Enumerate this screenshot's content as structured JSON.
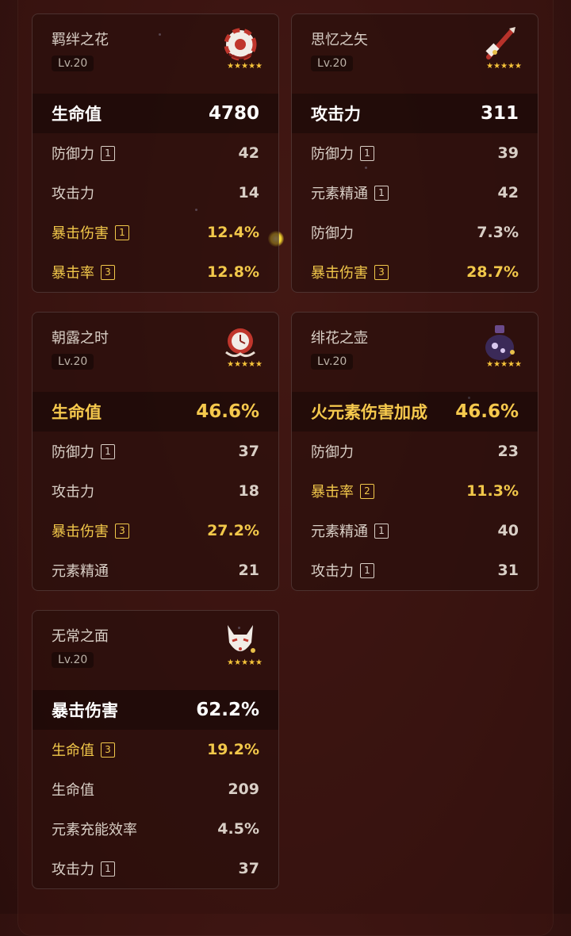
{
  "colors": {
    "highlight": "#f2c84a",
    "rarity_star": "#f5c33a",
    "background": "#3a1512"
  },
  "artifacts": [
    {
      "name": "羁绊之花",
      "level": "Lv.20",
      "rarity": "★★★★★",
      "icon": "flower-icon",
      "main": {
        "name": "生命值",
        "value": "4780",
        "highlight": false
      },
      "subs": [
        {
          "name": "防御力",
          "badge": "1",
          "value": "42",
          "highlight": false
        },
        {
          "name": "攻击力",
          "badge": "",
          "value": "14",
          "highlight": false
        },
        {
          "name": "暴击伤害",
          "badge": "1",
          "value": "12.4%",
          "highlight": true
        },
        {
          "name": "暴击率",
          "badge": "3",
          "value": "12.8%",
          "highlight": true
        }
      ]
    },
    {
      "name": "思忆之矢",
      "level": "Lv.20",
      "rarity": "★★★★★",
      "icon": "plume-icon",
      "main": {
        "name": "攻击力",
        "value": "311",
        "highlight": false
      },
      "subs": [
        {
          "name": "防御力",
          "badge": "1",
          "value": "39",
          "highlight": false
        },
        {
          "name": "元素精通",
          "badge": "1",
          "value": "42",
          "highlight": false
        },
        {
          "name": "防御力",
          "badge": "",
          "value": "7.3%",
          "highlight": false
        },
        {
          "name": "暴击伤害",
          "badge": "3",
          "value": "28.7%",
          "highlight": true
        }
      ]
    },
    {
      "name": "朝露之时",
      "level": "Lv.20",
      "rarity": "★★★★★",
      "icon": "sands-icon",
      "main": {
        "name": "生命值",
        "value": "46.6%",
        "highlight": true
      },
      "subs": [
        {
          "name": "防御力",
          "badge": "1",
          "value": "37",
          "highlight": false
        },
        {
          "name": "攻击力",
          "badge": "",
          "value": "18",
          "highlight": false
        },
        {
          "name": "暴击伤害",
          "badge": "3",
          "value": "27.2%",
          "highlight": true
        },
        {
          "name": "元素精通",
          "badge": "",
          "value": "21",
          "highlight": false
        }
      ]
    },
    {
      "name": "绯花之壶",
      "level": "Lv.20",
      "rarity": "★★★★★",
      "icon": "goblet-icon",
      "main": {
        "name": "火元素伤害加成",
        "value": "46.6%",
        "highlight": true
      },
      "subs": [
        {
          "name": "防御力",
          "badge": "",
          "value": "23",
          "highlight": false
        },
        {
          "name": "暴击率",
          "badge": "2",
          "value": "11.3%",
          "highlight": true
        },
        {
          "name": "元素精通",
          "badge": "1",
          "value": "40",
          "highlight": false
        },
        {
          "name": "攻击力",
          "badge": "1",
          "value": "31",
          "highlight": false
        }
      ]
    },
    {
      "name": "无常之面",
      "level": "Lv.20",
      "rarity": "★★★★★",
      "icon": "mask-icon",
      "main": {
        "name": "暴击伤害",
        "value": "62.2%",
        "highlight": false
      },
      "subs": [
        {
          "name": "生命值",
          "badge": "3",
          "value": "19.2%",
          "highlight": true
        },
        {
          "name": "生命值",
          "badge": "",
          "value": "209",
          "highlight": false
        },
        {
          "name": "元素充能效率",
          "badge": "",
          "value": "4.5%",
          "highlight": false
        },
        {
          "name": "攻击力",
          "badge": "1",
          "value": "37",
          "highlight": false
        }
      ]
    }
  ]
}
